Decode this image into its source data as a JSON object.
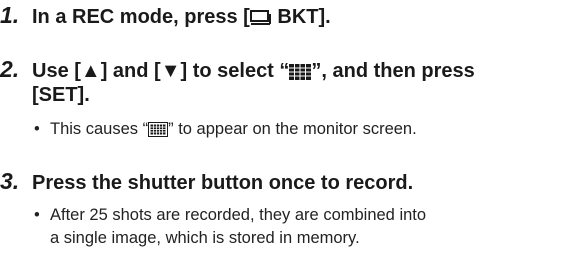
{
  "steps": [
    {
      "number": "1.",
      "text_before_icon": "In a REC mode, press [",
      "icon": "continuous-shooting-icon",
      "text_after_icon": " BKT]."
    },
    {
      "number": "2.",
      "text_before_icon": "Use [▲] and [▼] to select “",
      "icon": "grid-mode-icon",
      "text_after_icon": "”, and then press",
      "continuation": "[SET].",
      "bullets": [
        {
          "dot": "•",
          "text_before_icon": "This causes “",
          "icon": "grid-display-icon",
          "text_after_icon": "”  to appear on the monitor screen."
        }
      ]
    },
    {
      "number": "3.",
      "text": "Press the shutter button once to record.",
      "bullets": [
        {
          "dot": "•",
          "text": "After 25 shots are recorded, they are combined into",
          "continuation": "a single image, which is stored in memory."
        }
      ]
    }
  ]
}
